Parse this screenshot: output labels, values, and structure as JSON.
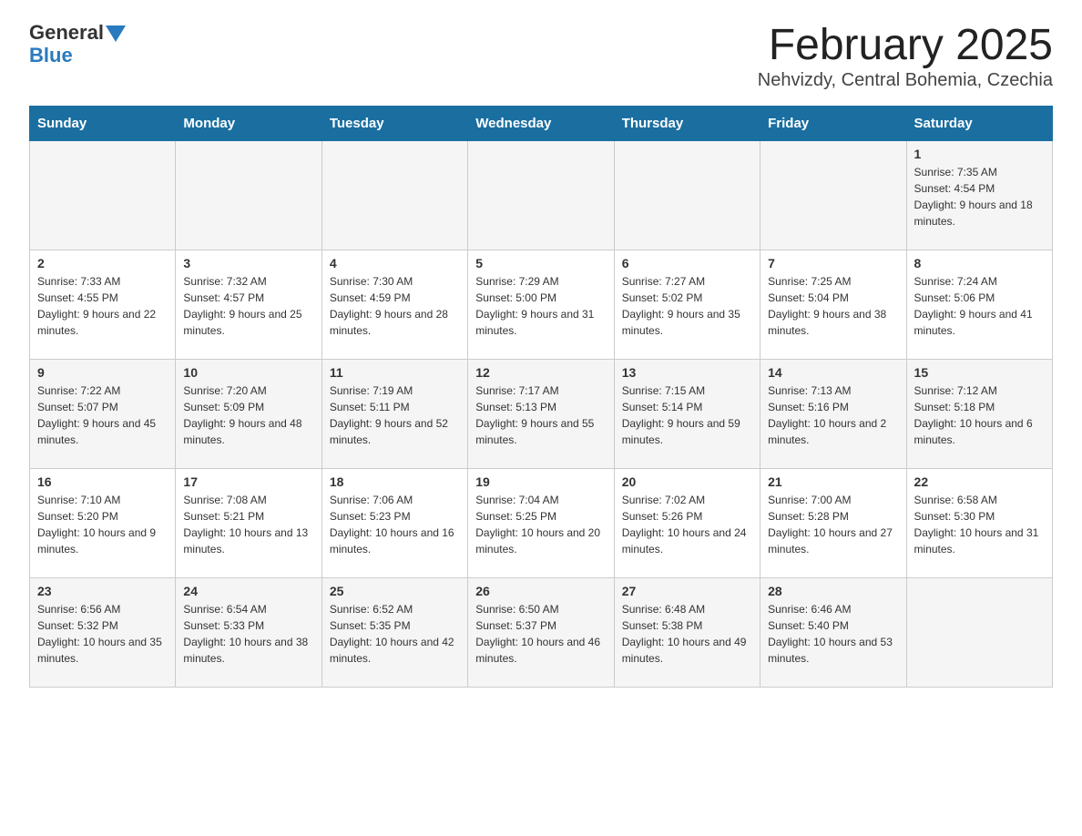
{
  "logo": {
    "name1": "General",
    "arrow": "▼",
    "name2": "Blue"
  },
  "title": "February 2025",
  "subtitle": "Nehvizdy, Central Bohemia, Czechia",
  "days_of_week": [
    "Sunday",
    "Monday",
    "Tuesday",
    "Wednesday",
    "Thursday",
    "Friday",
    "Saturday"
  ],
  "weeks": [
    [
      {
        "day": "",
        "info": ""
      },
      {
        "day": "",
        "info": ""
      },
      {
        "day": "",
        "info": ""
      },
      {
        "day": "",
        "info": ""
      },
      {
        "day": "",
        "info": ""
      },
      {
        "day": "",
        "info": ""
      },
      {
        "day": "1",
        "info": "Sunrise: 7:35 AM\nSunset: 4:54 PM\nDaylight: 9 hours and 18 minutes."
      }
    ],
    [
      {
        "day": "2",
        "info": "Sunrise: 7:33 AM\nSunset: 4:55 PM\nDaylight: 9 hours and 22 minutes."
      },
      {
        "day": "3",
        "info": "Sunrise: 7:32 AM\nSunset: 4:57 PM\nDaylight: 9 hours and 25 minutes."
      },
      {
        "day": "4",
        "info": "Sunrise: 7:30 AM\nSunset: 4:59 PM\nDaylight: 9 hours and 28 minutes."
      },
      {
        "day": "5",
        "info": "Sunrise: 7:29 AM\nSunset: 5:00 PM\nDaylight: 9 hours and 31 minutes."
      },
      {
        "day": "6",
        "info": "Sunrise: 7:27 AM\nSunset: 5:02 PM\nDaylight: 9 hours and 35 minutes."
      },
      {
        "day": "7",
        "info": "Sunrise: 7:25 AM\nSunset: 5:04 PM\nDaylight: 9 hours and 38 minutes."
      },
      {
        "day": "8",
        "info": "Sunrise: 7:24 AM\nSunset: 5:06 PM\nDaylight: 9 hours and 41 minutes."
      }
    ],
    [
      {
        "day": "9",
        "info": "Sunrise: 7:22 AM\nSunset: 5:07 PM\nDaylight: 9 hours and 45 minutes."
      },
      {
        "day": "10",
        "info": "Sunrise: 7:20 AM\nSunset: 5:09 PM\nDaylight: 9 hours and 48 minutes."
      },
      {
        "day": "11",
        "info": "Sunrise: 7:19 AM\nSunset: 5:11 PM\nDaylight: 9 hours and 52 minutes."
      },
      {
        "day": "12",
        "info": "Sunrise: 7:17 AM\nSunset: 5:13 PM\nDaylight: 9 hours and 55 minutes."
      },
      {
        "day": "13",
        "info": "Sunrise: 7:15 AM\nSunset: 5:14 PM\nDaylight: 9 hours and 59 minutes."
      },
      {
        "day": "14",
        "info": "Sunrise: 7:13 AM\nSunset: 5:16 PM\nDaylight: 10 hours and 2 minutes."
      },
      {
        "day": "15",
        "info": "Sunrise: 7:12 AM\nSunset: 5:18 PM\nDaylight: 10 hours and 6 minutes."
      }
    ],
    [
      {
        "day": "16",
        "info": "Sunrise: 7:10 AM\nSunset: 5:20 PM\nDaylight: 10 hours and 9 minutes."
      },
      {
        "day": "17",
        "info": "Sunrise: 7:08 AM\nSunset: 5:21 PM\nDaylight: 10 hours and 13 minutes."
      },
      {
        "day": "18",
        "info": "Sunrise: 7:06 AM\nSunset: 5:23 PM\nDaylight: 10 hours and 16 minutes."
      },
      {
        "day": "19",
        "info": "Sunrise: 7:04 AM\nSunset: 5:25 PM\nDaylight: 10 hours and 20 minutes."
      },
      {
        "day": "20",
        "info": "Sunrise: 7:02 AM\nSunset: 5:26 PM\nDaylight: 10 hours and 24 minutes."
      },
      {
        "day": "21",
        "info": "Sunrise: 7:00 AM\nSunset: 5:28 PM\nDaylight: 10 hours and 27 minutes."
      },
      {
        "day": "22",
        "info": "Sunrise: 6:58 AM\nSunset: 5:30 PM\nDaylight: 10 hours and 31 minutes."
      }
    ],
    [
      {
        "day": "23",
        "info": "Sunrise: 6:56 AM\nSunset: 5:32 PM\nDaylight: 10 hours and 35 minutes."
      },
      {
        "day": "24",
        "info": "Sunrise: 6:54 AM\nSunset: 5:33 PM\nDaylight: 10 hours and 38 minutes."
      },
      {
        "day": "25",
        "info": "Sunrise: 6:52 AM\nSunset: 5:35 PM\nDaylight: 10 hours and 42 minutes."
      },
      {
        "day": "26",
        "info": "Sunrise: 6:50 AM\nSunset: 5:37 PM\nDaylight: 10 hours and 46 minutes."
      },
      {
        "day": "27",
        "info": "Sunrise: 6:48 AM\nSunset: 5:38 PM\nDaylight: 10 hours and 49 minutes."
      },
      {
        "day": "28",
        "info": "Sunrise: 6:46 AM\nSunset: 5:40 PM\nDaylight: 10 hours and 53 minutes."
      },
      {
        "day": "",
        "info": ""
      }
    ]
  ]
}
